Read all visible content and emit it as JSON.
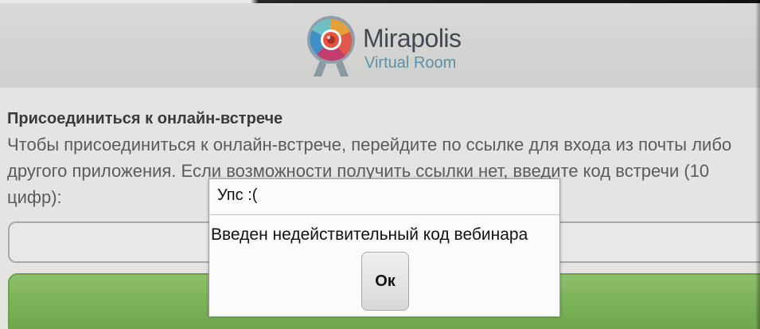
{
  "header": {
    "logo": {
      "title": "Mirapolis",
      "subtitle_part1": "Virtual ",
      "subtitle_part2": "Room"
    }
  },
  "main": {
    "title": "Присоединиться к онлайн-встрече",
    "description": "Чтобы присоединиться к онлайн-встрече, перейдите по ссылке для входа из почты либо другого приложения. Если возможности получить ссылки нет, введите код встречи (10 цифр):",
    "code_input": {
      "value": "",
      "placeholder": ""
    },
    "join_button_label": ""
  },
  "dialog": {
    "title": "Упс :(",
    "message": "Введен недействительный код вебинара",
    "ok_label": "Ок"
  },
  "colors": {
    "join_button": "#7eb35a",
    "logo_text": "#3f4a53",
    "logo_subtitle": "#5b91a6"
  },
  "icons": {
    "logo": "mirapolis-camera-logo-icon"
  }
}
